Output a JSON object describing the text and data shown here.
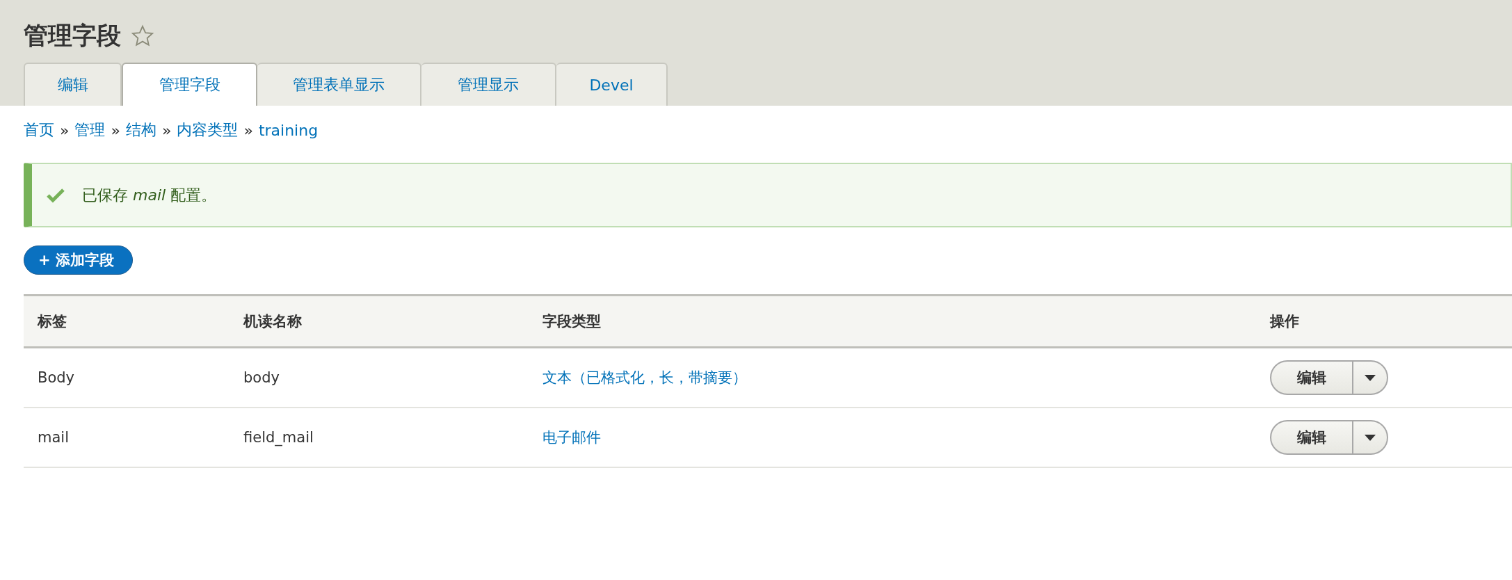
{
  "page_title": "管理字段",
  "tabs": [
    {
      "label": "编辑",
      "selected": false
    },
    {
      "label": "管理字段",
      "selected": true
    },
    {
      "label": "管理表单显示",
      "selected": false
    },
    {
      "label": "管理显示",
      "selected": false
    },
    {
      "label": "Devel",
      "selected": false
    }
  ],
  "breadcrumb": [
    "首页",
    "管理",
    "结构",
    "内容类型",
    "training"
  ],
  "breadcrumb_separator": "»",
  "status_message": "已保存 *mail* 配置。",
  "add_button": "+ 添加字段",
  "table": {
    "columns": [
      "标签",
      "机读名称",
      "字段类型",
      "操作"
    ],
    "rows": [
      {
        "label": "Body",
        "machine_name": "body",
        "field_type": "文本（已格式化，长，带摘要）",
        "action": "编辑"
      },
      {
        "label": "mail",
        "machine_name": "field_mail",
        "field_type": "电子邮件",
        "action": "编辑"
      }
    ]
  }
}
